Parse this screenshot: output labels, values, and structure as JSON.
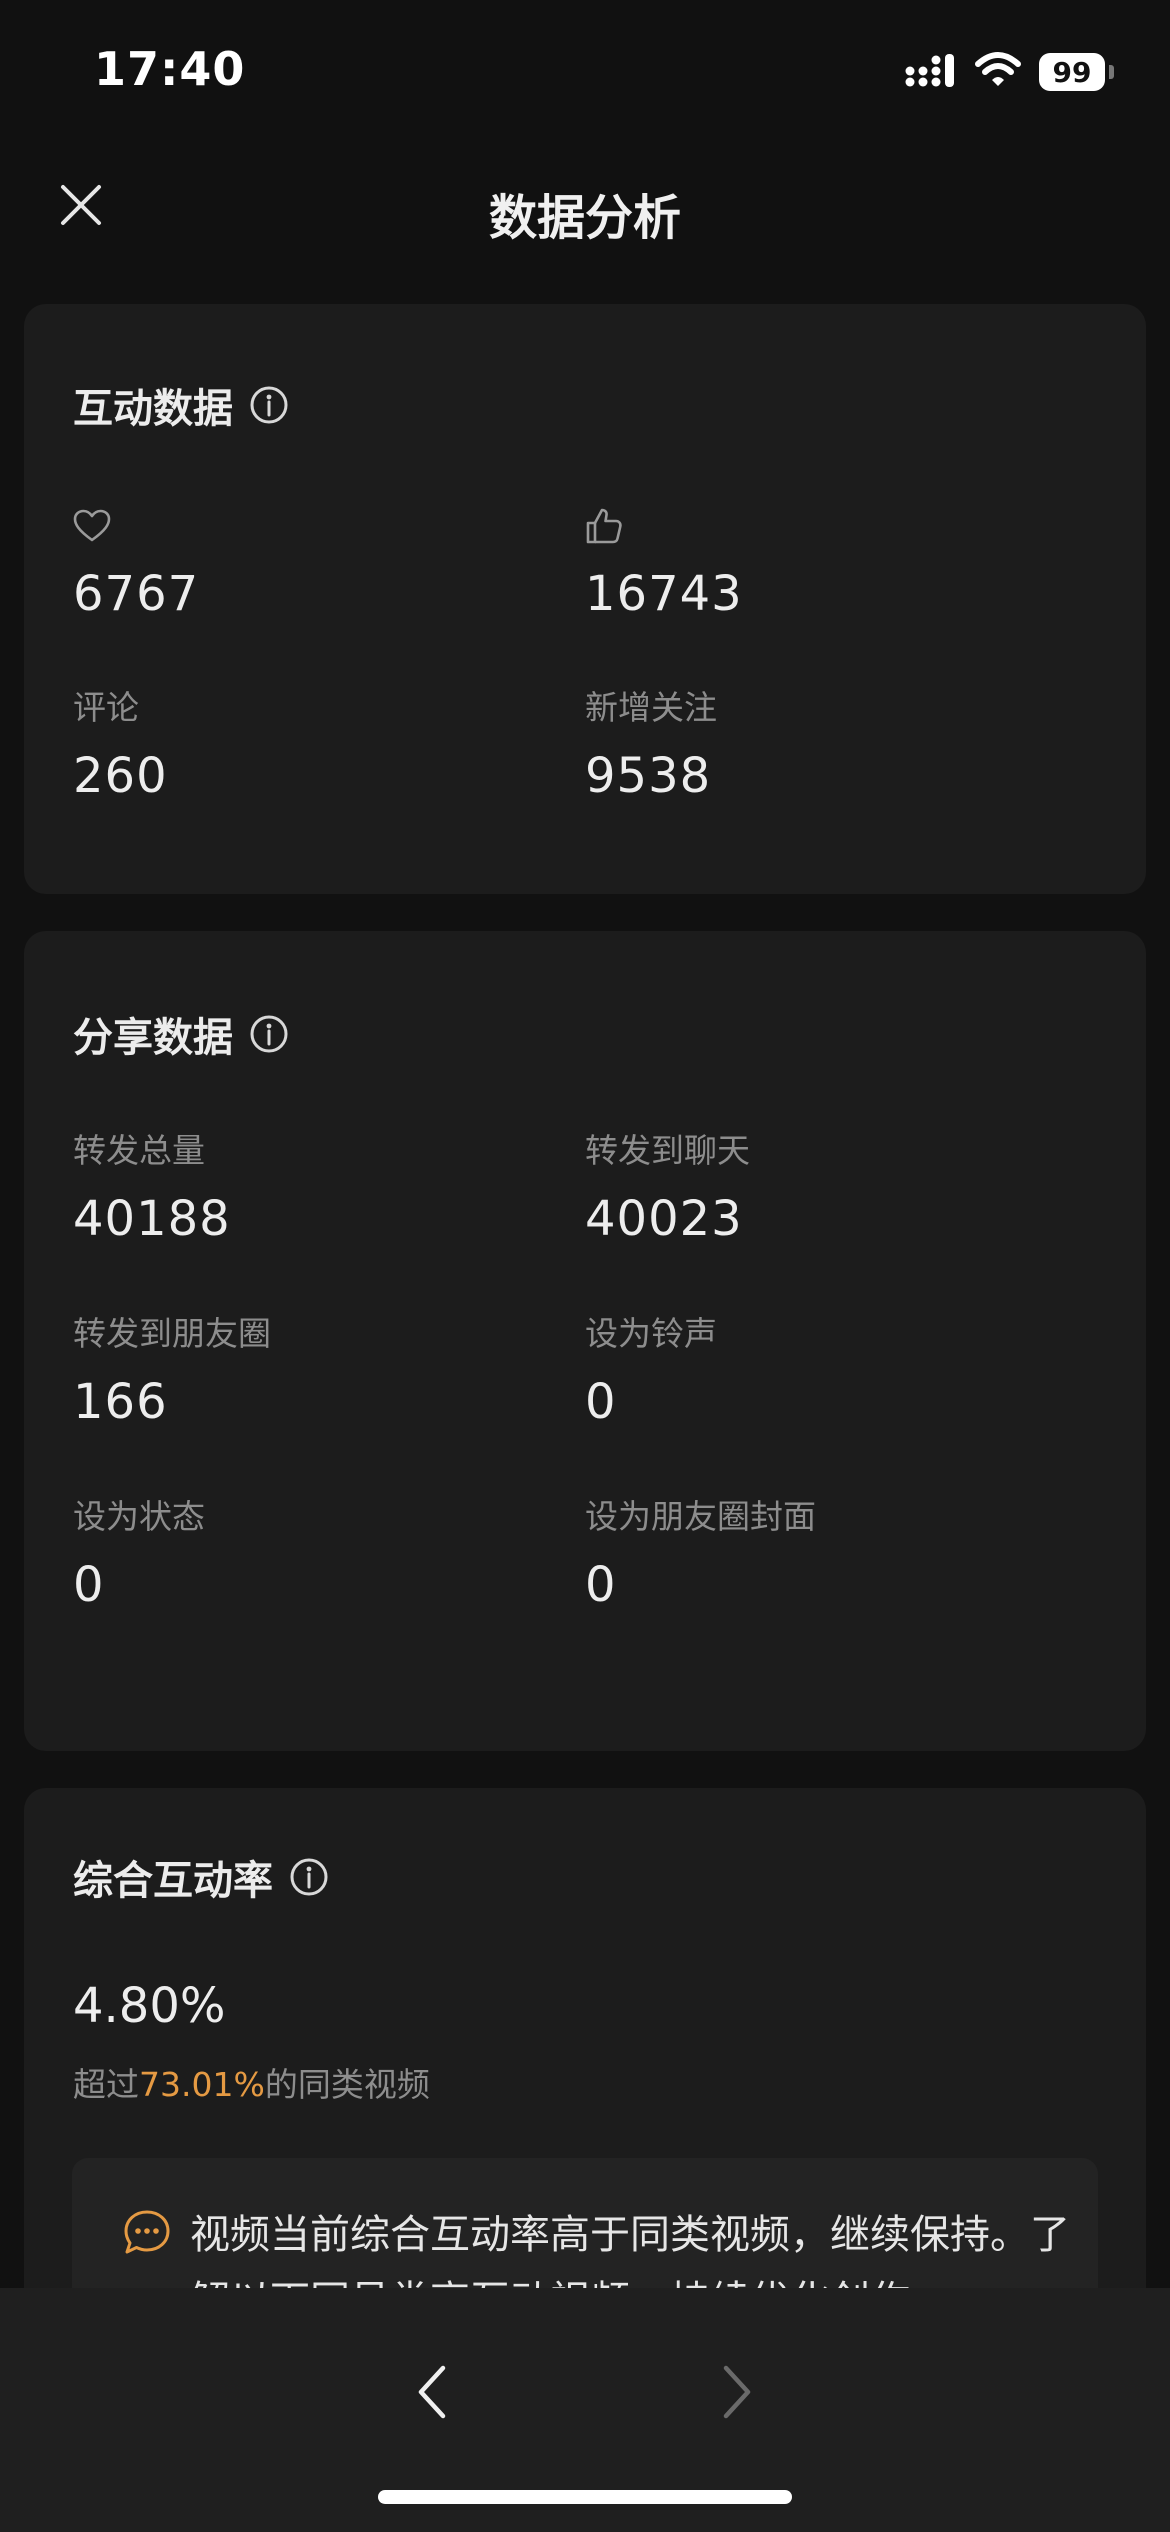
{
  "status_bar": {
    "time": "17:40",
    "battery": "99",
    "icons": [
      "signal-icon",
      "wifi-icon",
      "battery-icon"
    ]
  },
  "header": {
    "title": "数据分析",
    "close_icon": "close-icon"
  },
  "interaction": {
    "title": "互动数据",
    "info_icon": "info-icon",
    "stats": [
      {
        "icon": "heart-icon",
        "value": "6767"
      },
      {
        "icon": "thumbs-up-icon",
        "value": "16743"
      },
      {
        "label": "评论",
        "value": "260"
      },
      {
        "label": "新增关注",
        "value": "9538"
      }
    ]
  },
  "share": {
    "title": "分享数据",
    "info_icon": "info-icon",
    "stats": [
      {
        "label": "转发总量",
        "value": "40188"
      },
      {
        "label": "转发到聊天",
        "value": "40023"
      },
      {
        "label": "转发到朋友圈",
        "value": "166"
      },
      {
        "label": "设为铃声",
        "value": "0"
      },
      {
        "label": "设为状态",
        "value": "0"
      },
      {
        "label": "设为朋友圈封面",
        "value": "0"
      }
    ]
  },
  "engagement": {
    "title": "综合互动率",
    "info_icon": "info-icon",
    "rate": "4.80%",
    "compare_prefix": "超过",
    "compare_highlight": "73.01%",
    "compare_suffix": "的同类视频",
    "tip_icon": "comment-bubble-icon",
    "tip_text": "视频当前综合互动率高于同类视频，继续保持。了解以下同号类高互动视频，持续优化创作。"
  },
  "bottom_bar": {
    "back_icon": "chevron-left-icon",
    "forward_icon": "chevron-right-icon"
  },
  "colors": {
    "background": "#111111",
    "card": "#1c1c1c",
    "highlight": "#e59a43",
    "label": "#8d8d8d"
  }
}
